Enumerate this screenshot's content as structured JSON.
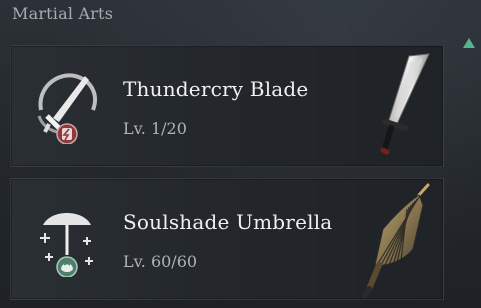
{
  "section_title": "Martial Arts",
  "colors": {
    "background": "#23272b",
    "accent_green": "#59b28e",
    "badge_red": "#8c3a3d",
    "badge_green": "#4f7f6a"
  },
  "weapons": [
    {
      "name": "Thundercry Blade",
      "level": "Lv. 1/20",
      "icon": "thundercry-blade-icon",
      "artwork": "sword-artwork"
    },
    {
      "name": "Soulshade Umbrella",
      "level": "Lv. 60/60",
      "icon": "soulshade-umbrella-icon",
      "artwork": "umbrella-artwork"
    }
  ]
}
